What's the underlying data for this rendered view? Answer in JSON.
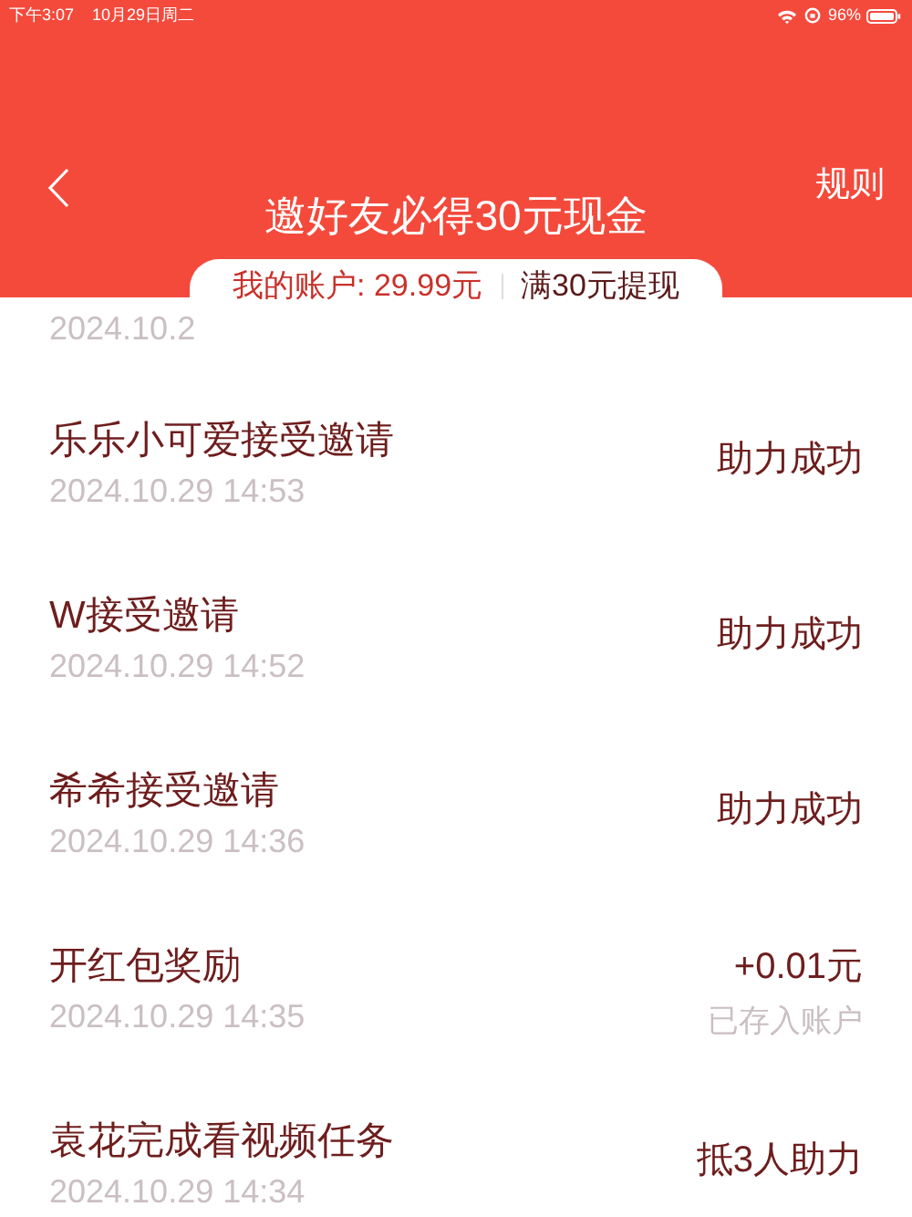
{
  "status_bar": {
    "time": "下午3:07",
    "date": "10月29日周二",
    "battery": "96%"
  },
  "header": {
    "title": "邀好友必得30元现金",
    "rules_link": "规则"
  },
  "account": {
    "balance": "我的账户: 29.99元",
    "withdraw": "满30元提现"
  },
  "partial_record": {
    "time": "2024.10.2"
  },
  "records": [
    {
      "title": "乐乐小可爱接受邀请",
      "time": "2024.10.29 14:53",
      "status": "助力成功"
    },
    {
      "title": "W接受邀请",
      "time": "2024.10.29 14:52",
      "status": "助力成功"
    },
    {
      "title": "希希接受邀请",
      "time": "2024.10.29 14:36",
      "status": "助力成功"
    },
    {
      "title": "开红包奖励",
      "time": "2024.10.29 14:35",
      "status": "+0.01元",
      "note": "已存入账户"
    },
    {
      "title": "袁花完成看视频任务",
      "time": "2024.10.29 14:34",
      "status": "抵3人助力"
    }
  ]
}
